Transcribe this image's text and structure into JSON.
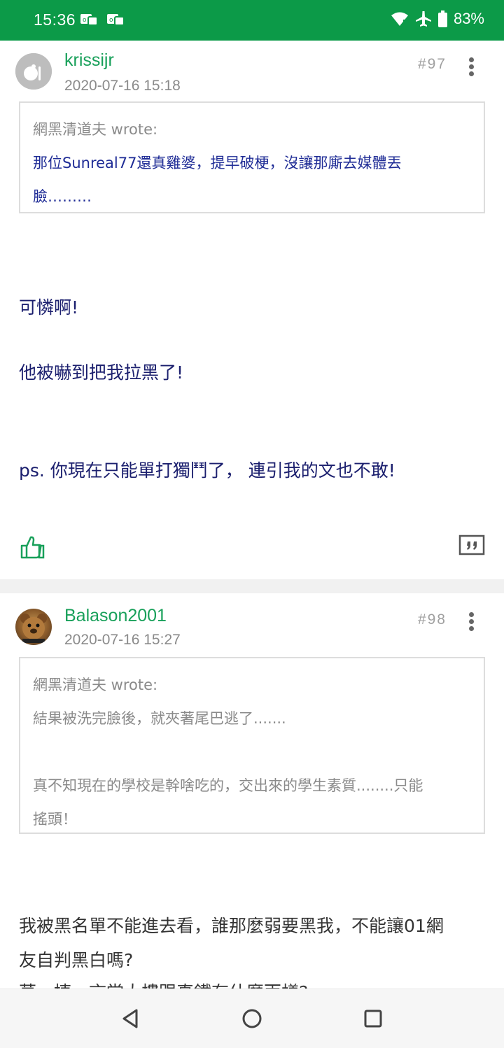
{
  "status_bar": {
    "time": "15:36",
    "battery": "83%",
    "icons": [
      "notification-icon",
      "notification-icon",
      "wifi-icon",
      "airplane-icon",
      "battery-icon"
    ]
  },
  "posts": [
    {
      "username": "krissijr",
      "timestamp": "2020-07-16 15:18",
      "floor": "#97",
      "quote": {
        "author": "網黑清道夫 wrote:",
        "lines": [
          "那位Sunreal77還真雞婆，提早破梗，沒讓那廝去媒體丟",
          "臉………"
        ]
      },
      "body": [
        "可憐啊!",
        "他被嚇到把我拉黑了!",
        "ps. 你現在只能單打獨鬥了， 連引我的文也不敢!"
      ]
    },
    {
      "username": "Balason2001",
      "timestamp": "2020-07-16 15:27",
      "floor": "#98",
      "quote": {
        "author": "網黑清道夫 wrote:",
        "lines": [
          "結果被洗完臉後，就夾著尾巴逃了.......",
          "",
          "真不知現在的學校是幹啥吃的，交出來的學生素質........只能",
          "搖頭！"
        ]
      },
      "body": [
        "我被黑名單不能進去看，誰那麼弱要黑我，不能讓01網",
        "友自判黑白嗎?",
        "莫一捷，言堂大樓跟真鐵有什麼兩樣?"
      ]
    }
  ],
  "colors": {
    "status_bar": "#0c9a48",
    "username": "#18a05a",
    "quote_text": "#1f2c96",
    "body_text": "#1b1f6e"
  },
  "nav_bar": {
    "icons": [
      "back-icon",
      "home-icon",
      "recents-icon"
    ]
  }
}
